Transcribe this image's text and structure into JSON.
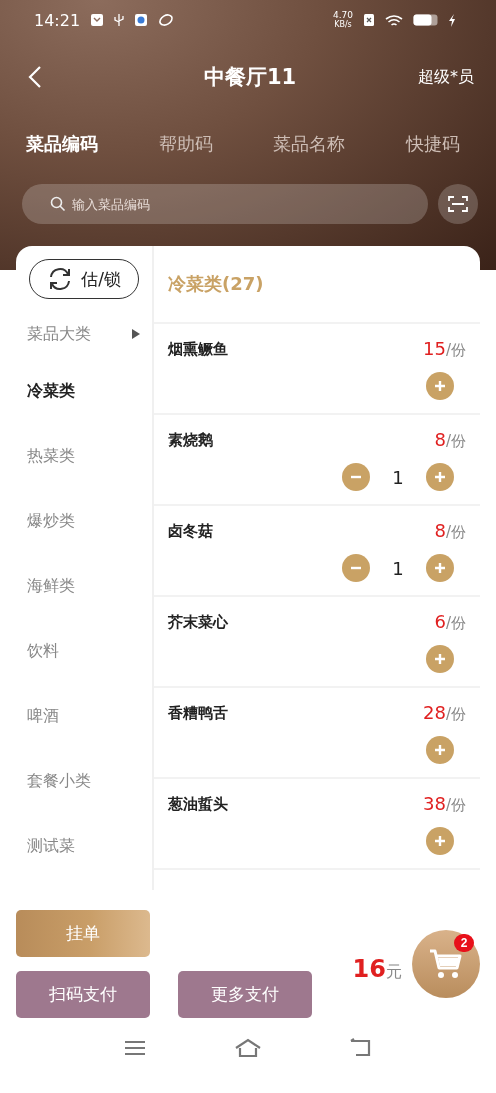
{
  "status_bar": {
    "time": "14:21",
    "speed_value": "4.70",
    "speed_unit": "KB/s"
  },
  "header": {
    "title": "中餐厅11",
    "user": "超级*员"
  },
  "tabs": [
    {
      "label": "菜品编码",
      "selected": true
    },
    {
      "label": "帮助码",
      "selected": false
    },
    {
      "label": "菜品名称",
      "selected": false
    },
    {
      "label": "快捷码",
      "selected": false
    }
  ],
  "search": {
    "placeholder": "输入菜品编码"
  },
  "estimate_button": {
    "label": "估/锁"
  },
  "sidebar": {
    "items": [
      {
        "label": "菜品大类",
        "kind": "group",
        "selected": false
      },
      {
        "label": "冷菜类",
        "kind": "category",
        "selected": true
      },
      {
        "label": "热菜类",
        "kind": "category",
        "selected": false
      },
      {
        "label": "爆炒类",
        "kind": "category",
        "selected": false
      },
      {
        "label": "海鲜类",
        "kind": "category",
        "selected": false
      },
      {
        "label": "饮料",
        "kind": "category",
        "selected": false
      },
      {
        "label": "啤酒",
        "kind": "category",
        "selected": false
      },
      {
        "label": "套餐小类",
        "kind": "category",
        "selected": false
      },
      {
        "label": "测试菜",
        "kind": "category",
        "selected": false
      }
    ]
  },
  "category_title": "冷菜类(27)",
  "dishes": [
    {
      "name": "烟熏鳜鱼",
      "price": "15",
      "unit": "/份"
    },
    {
      "name": "素烧鹅",
      "price": "8",
      "unit": "/份",
      "quantity": "1"
    },
    {
      "name": "卤冬菇",
      "price": "8",
      "unit": "/份",
      "quantity": "1"
    },
    {
      "name": "芥末菜心",
      "price": "6",
      "unit": "/份"
    },
    {
      "name": "香糟鸭舌",
      "price": "28",
      "unit": "/份"
    },
    {
      "name": "葱油蜇头",
      "price": "38",
      "unit": "/份"
    }
  ],
  "footer": {
    "hold_button": "挂单",
    "pay_buttons": [
      "扫码支付",
      "更多支付"
    ],
    "total": "16",
    "currency": "元",
    "cart_count": "2"
  }
}
